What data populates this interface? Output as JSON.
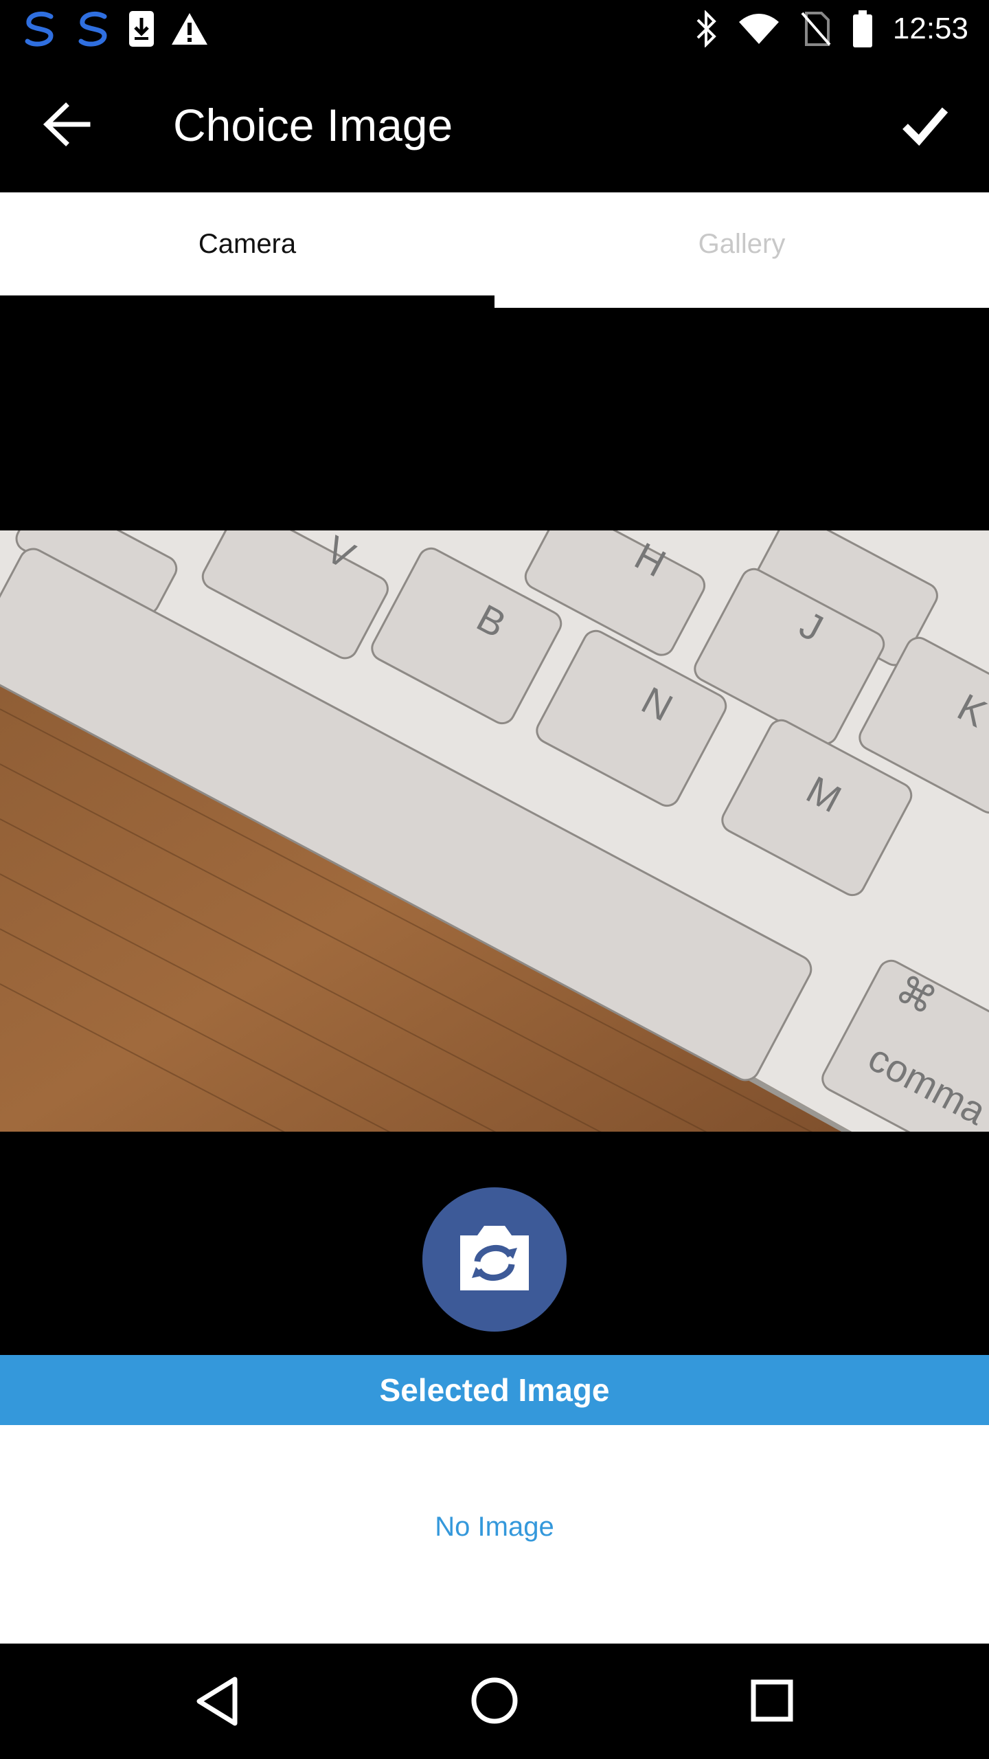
{
  "status_bar": {
    "time": "12:53",
    "left_icons": [
      "s-app-icon",
      "s-app-icon",
      "download-icon",
      "warning-icon"
    ],
    "right_icons": [
      "bluetooth-icon",
      "wifi-icon",
      "no-sim-icon",
      "battery-icon"
    ]
  },
  "app_bar": {
    "title": "Choice Image",
    "back_icon": "arrow-left-icon",
    "confirm_icon": "check-icon"
  },
  "tabs": [
    {
      "label": "Camera",
      "selected": true
    },
    {
      "label": "Gallery",
      "selected": false
    }
  ],
  "camera": {
    "shutter_icon": "camera-switch-icon",
    "preview_key_labels": [
      "V",
      "H",
      "B",
      "J",
      "N",
      "M",
      "K",
      "⌘",
      "comma"
    ]
  },
  "selected": {
    "header": "Selected Image",
    "empty_text": "No Image"
  },
  "nav_bar": {
    "buttons": [
      "back-triangle-icon",
      "home-circle-icon",
      "recents-square-icon"
    ]
  },
  "colors": {
    "accent_blue": "#3498db",
    "shutter_blue": "#3d5a98"
  }
}
